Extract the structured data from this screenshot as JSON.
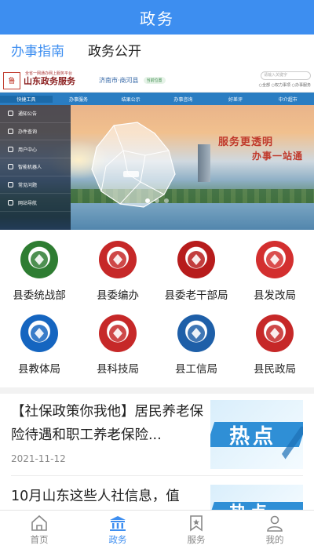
{
  "app": {
    "title": "政务"
  },
  "tabs": [
    {
      "label": "办事指南",
      "active": true
    },
    {
      "label": "政务公开",
      "active": false
    }
  ],
  "banner": {
    "site_name": "山东政务服务",
    "site_subtitle": "全省一网通办网上服务平台",
    "location": "济南市·商河县",
    "location_pill": "当前位置",
    "search_placeholder": "请输入关键字",
    "search_scopes": [
      "全部",
      "权力事项",
      "办事服务"
    ],
    "nav_items": [
      "快捷工具",
      "办事服务",
      "结果公示",
      "办事咨询",
      "好差评",
      "中介超市"
    ],
    "side_menu": [
      "通知公告",
      "办件查询",
      "用户中心",
      "智能机器人",
      "常见问题",
      "网站导航"
    ],
    "slogan_line1": "服务更透明",
    "slogan_line2": "办事一站通",
    "slide_count": 3,
    "active_slide": 0
  },
  "departments": [
    {
      "label": "县委统战部",
      "icon": "united-front-icon",
      "color": "#2e7d32"
    },
    {
      "label": "县委编办",
      "icon": "party-emblem-icon",
      "color": "#c62828"
    },
    {
      "label": "县委老干部局",
      "icon": "veteran-cadres-icon",
      "color": "#b71c1c"
    },
    {
      "label": "县发改局",
      "icon": "development-reform-icon",
      "color": "#d32f2f"
    },
    {
      "label": "县教体局",
      "icon": "education-sports-icon",
      "color": "#1565c0"
    },
    {
      "label": "县科技局",
      "icon": "science-tech-icon",
      "color": "#c62828"
    },
    {
      "label": "县工信局",
      "icon": "industry-it-icon",
      "color": "#1e5fa8"
    },
    {
      "label": "县民政局",
      "icon": "civil-affairs-icon",
      "color": "#c62828"
    }
  ],
  "grid_pages": {
    "count": 2,
    "active": 0
  },
  "news": [
    {
      "title": "【社保政策你我他】居民养老保险待遇和职工养老保险...",
      "date": "2021-11-12",
      "thumb_text": "热点"
    },
    {
      "title": "10月山东这些人社信息，值",
      "date": "",
      "thumb_text": "热点"
    }
  ],
  "bottom_nav": [
    {
      "label": "首页",
      "icon": "home-icon",
      "active": false
    },
    {
      "label": "政务",
      "icon": "government-building-icon",
      "active": true
    },
    {
      "label": "服务",
      "icon": "service-bookmark-icon",
      "active": false
    },
    {
      "label": "我的",
      "icon": "user-profile-icon",
      "active": false
    }
  ],
  "colors": {
    "primary": "#3d8ef0",
    "inactive": "#888888",
    "banner_nav": "#2a7dc2"
  }
}
